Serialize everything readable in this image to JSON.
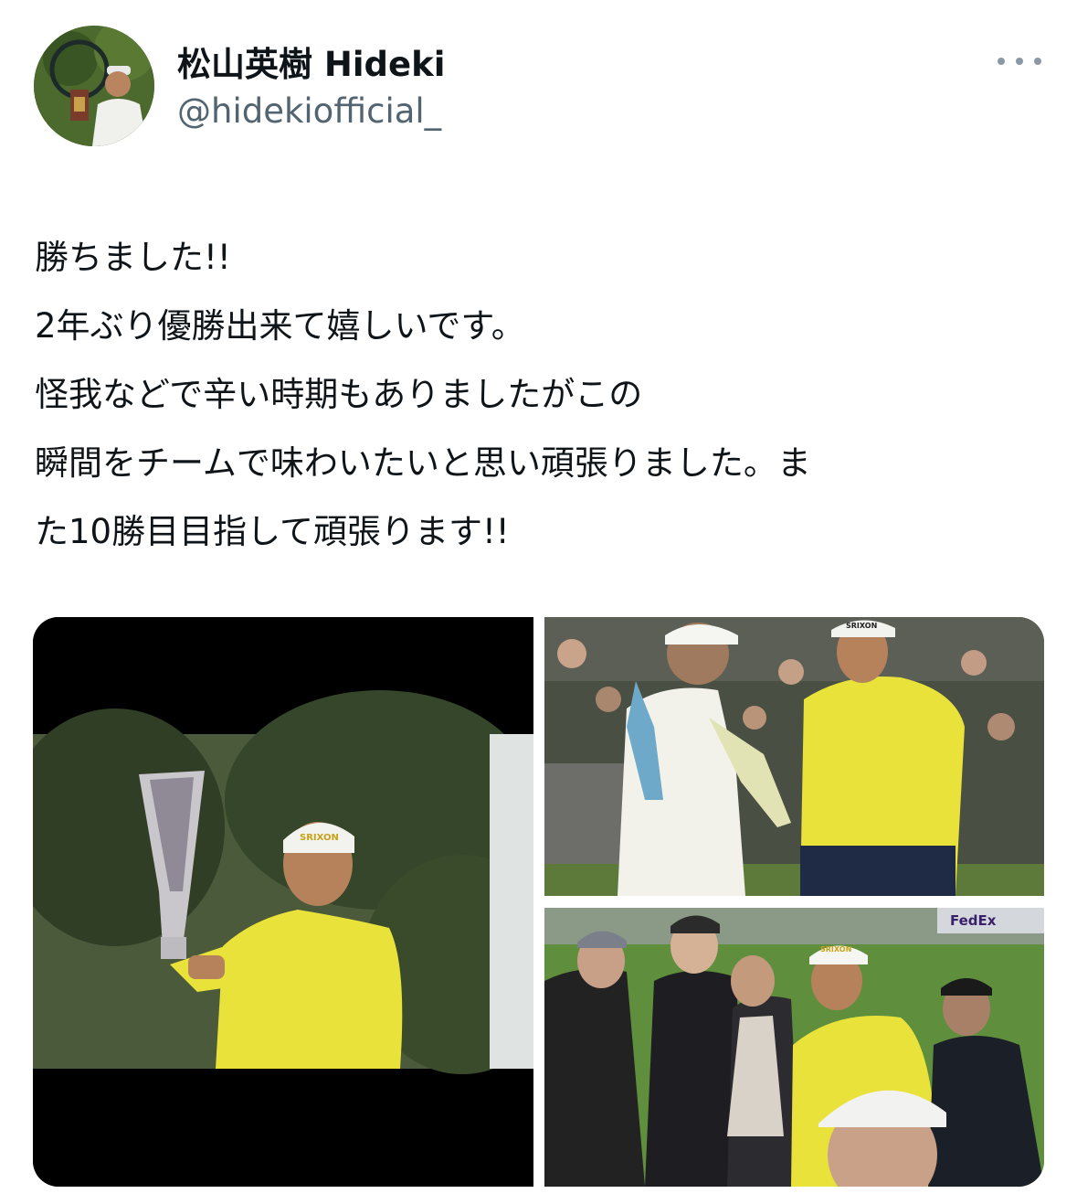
{
  "user": {
    "display_name": "松山英樹 Hideki",
    "handle": "@hidekiofficial_"
  },
  "menu": {
    "icon": "more-horizontal-icon"
  },
  "tweet": {
    "lines": [
      "勝ちました!!",
      "2年ぶり優勝出来て嬉しいです。",
      "怪我などで辛い時期もありましたがこの",
      "瞬間をチームで味わいたいと思い頑張りました。ま",
      "た10勝目目指して頑張ります!!"
    ]
  },
  "media": {
    "photos": [
      {
        "cap_text": "SRIXON"
      },
      {
        "cap_text": "SRIXON"
      },
      {
        "cap_text": "SRIXON",
        "banner_text": "FedEx"
      }
    ]
  }
}
